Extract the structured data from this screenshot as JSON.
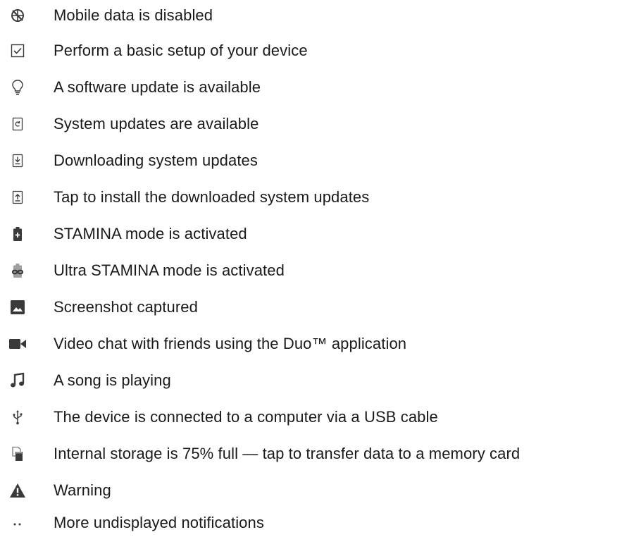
{
  "notifications": [
    {
      "icon": "mobile-data-disabled-icon",
      "text": "Mobile data is disabled"
    },
    {
      "icon": "checkbox-icon",
      "text": "Perform a basic setup of your device"
    },
    {
      "icon": "lightbulb-icon",
      "text": "A software update is available"
    },
    {
      "icon": "system-update-icon",
      "text": "System updates are available"
    },
    {
      "icon": "download-icon",
      "text": "Downloading system updates"
    },
    {
      "icon": "install-update-icon",
      "text": "Tap to install the downloaded system updates"
    },
    {
      "icon": "stamina-battery-icon",
      "text": "STAMINA mode is activated"
    },
    {
      "icon": "ultra-stamina-icon",
      "text": "Ultra STAMINA mode is activated"
    },
    {
      "icon": "screenshot-image-icon",
      "text": "Screenshot captured"
    },
    {
      "icon": "video-camera-icon",
      "text": "Video chat with friends using the Duo™ application"
    },
    {
      "icon": "music-note-icon",
      "text": "A song is playing"
    },
    {
      "icon": "usb-icon",
      "text": "The device is connected to a computer via a USB cable"
    },
    {
      "icon": "storage-card-icon",
      "text": "Internal storage is 75% full — tap to transfer data to a memory card"
    },
    {
      "icon": "warning-icon",
      "text": "Warning"
    },
    {
      "icon": "more-dots-icon",
      "text": "More undisplayed notifications"
    }
  ]
}
